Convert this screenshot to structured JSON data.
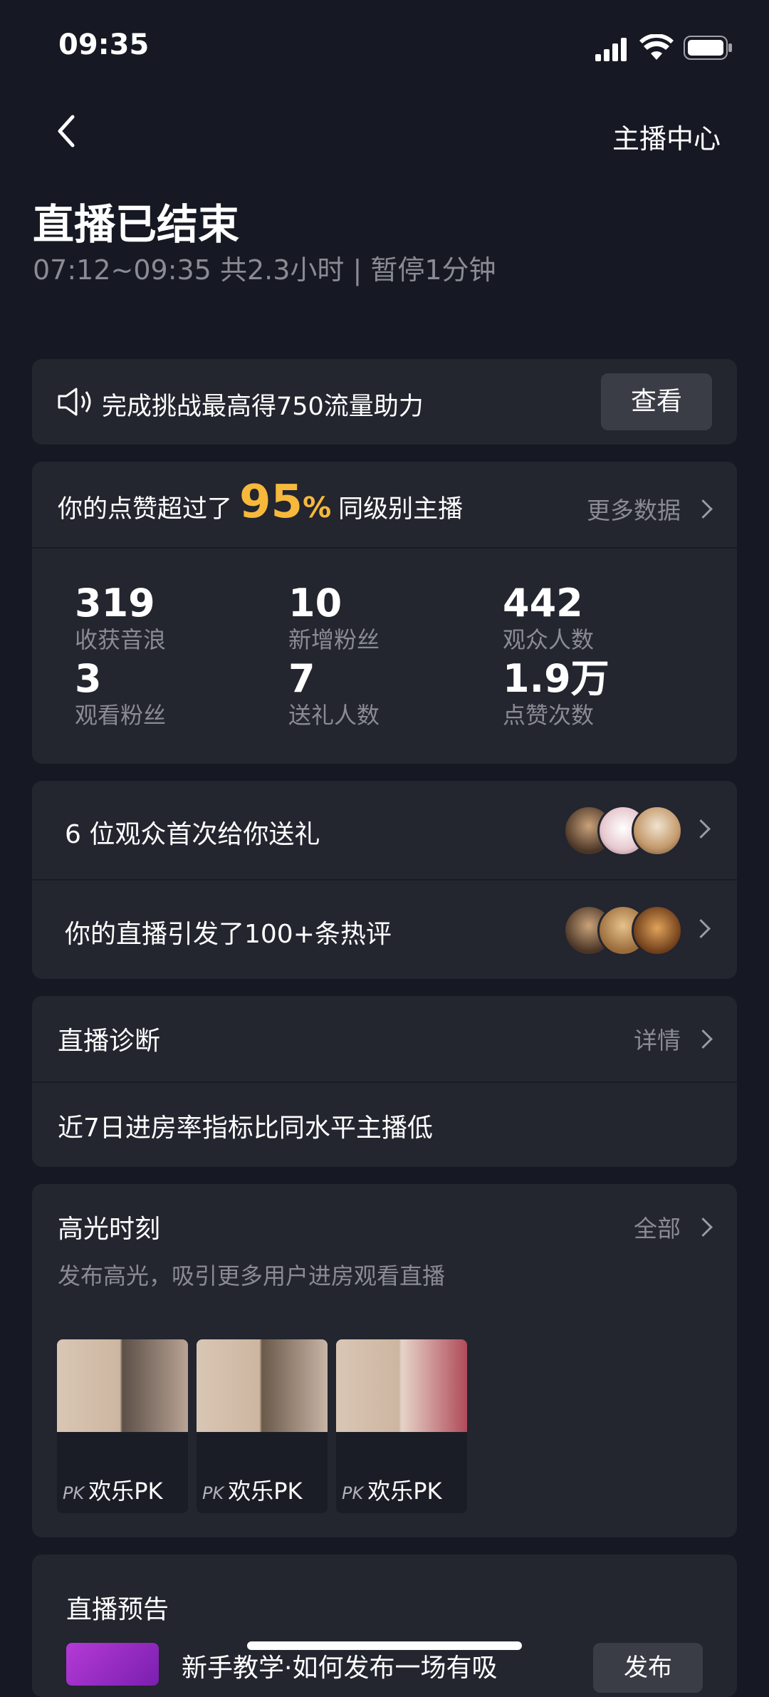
{
  "status_bar": {
    "time": "09:35"
  },
  "header": {
    "right_label": "主播中心"
  },
  "summary": {
    "title": "直播已结束",
    "subtitle": "07:12~09:35 共2.3小时 | 暂停1分钟"
  },
  "challenge": {
    "text": "完成挑战最高得750流量助力",
    "button": "查看"
  },
  "likes": {
    "prefix": "你的点赞超过了",
    "percent": "95",
    "percent_sign": "%",
    "suffix": "同级别主播",
    "more": "更多数据"
  },
  "stats": [
    {
      "value": "319",
      "label": "收获音浪"
    },
    {
      "value": "10",
      "label": "新增粉丝"
    },
    {
      "value": "442",
      "label": "观众人数"
    },
    {
      "value": "3",
      "label": "观看粉丝"
    },
    {
      "value": "7",
      "label": "送礼人数"
    },
    {
      "value": "1.9万",
      "label": "点赞次数"
    }
  ],
  "gift_row": {
    "text": "6 位观众首次给你送礼"
  },
  "comment_row": {
    "text": "你的直播引发了100+条热评"
  },
  "diagnosis": {
    "title": "直播诊断",
    "more": "详情",
    "text": "近7日进房率指标比同水平主播低"
  },
  "highlights": {
    "title": "高光时刻",
    "more": "全部",
    "subtitle": "发布高光，吸引更多用户进房观看直播",
    "clips": [
      {
        "tag": "PK",
        "label": "欢乐PK"
      },
      {
        "tag": "PK",
        "label": "欢乐PK"
      },
      {
        "tag": "PK",
        "label": "欢乐PK"
      }
    ]
  },
  "preview": {
    "title": "直播预告",
    "item_text": "新手教学·如何发布一场有吸",
    "button": "发布"
  },
  "colors": {
    "background": "#161823",
    "card": "#23252f",
    "accent": "#f6b93b",
    "muted": "#8a8b93"
  }
}
